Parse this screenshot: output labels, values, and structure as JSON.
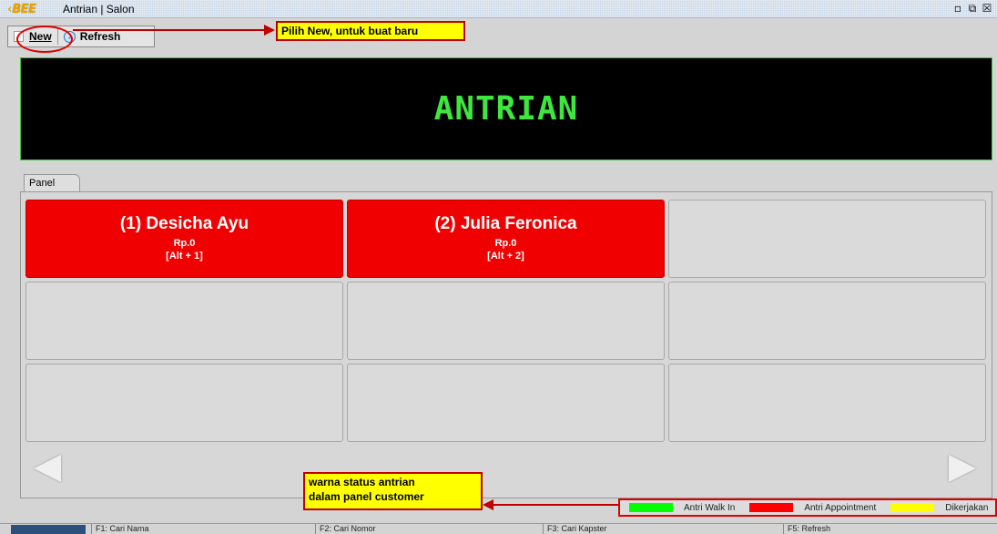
{
  "window": {
    "title": "Antrian | Salon",
    "logo_chevron": "‹",
    "logo_text": "BEE"
  },
  "toolbar": {
    "new_label": "New",
    "refresh_label": "Refresh"
  },
  "annotations": {
    "new_hint": "Pilih New, untuk buat baru",
    "status_hint_line1": "warna status antrian",
    "status_hint_line2": "dalam panel customer"
  },
  "banner": {
    "text": "ANTRIAN",
    "text_color": "#3ee63e",
    "background": "#000000"
  },
  "panel": {
    "tab_label": "Panel",
    "cards": [
      {
        "name": "(1) Desicha Ayu",
        "amount": "Rp.0",
        "shortcut": "[Alt + 1]",
        "status_color": "#f00000"
      },
      {
        "name": "(2) Julia Feronica",
        "amount": "Rp.0",
        "shortcut": "[Alt + 2]",
        "status_color": "#f00000"
      }
    ]
  },
  "legend": {
    "items": [
      {
        "label": "Antri Walk In",
        "color": "#00ff00"
      },
      {
        "label": "Antri Appointment",
        "color": "#ff0000"
      },
      {
        "label": "Dikerjakan",
        "color": "#ffff00"
      }
    ]
  },
  "statusbar": {
    "items": [
      "F1: Cari Nama",
      "F2: Cari Nomor",
      "F3: Cari Kapster",
      "F5: Refresh"
    ]
  },
  "icons": {
    "new": "new-document-icon",
    "refresh": "refresh-icon",
    "prev": "previous-arrow-icon",
    "next": "next-arrow-icon"
  }
}
